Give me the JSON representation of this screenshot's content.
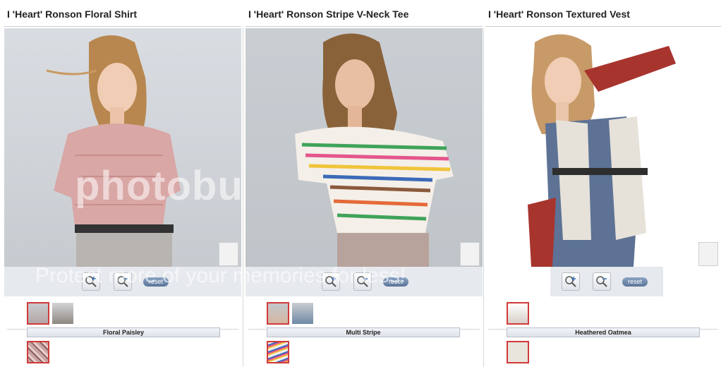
{
  "products": [
    {
      "title": "I 'Heart' Ronson Floral Shirt",
      "color_name": "Floral Paisley"
    },
    {
      "title": "I 'Heart' Ronson Stripe V-Neck Tee",
      "color_name": "Multi Stripe"
    },
    {
      "title": "I 'Heart' Ronson Textured Vest",
      "color_name": "Heathered Oatmea"
    }
  ],
  "controls": {
    "zoom_in": "zoom-in-icon",
    "zoom_out": "zoom-out-icon",
    "reset_label": "reset"
  },
  "watermark": {
    "main": "photobucket",
    "sub": "Protect more of your memories for less!"
  },
  "colors": {
    "selected_border": "#d13a3a",
    "control_bg": "#e6e9ee",
    "reset_bg": "#6b86a9"
  }
}
